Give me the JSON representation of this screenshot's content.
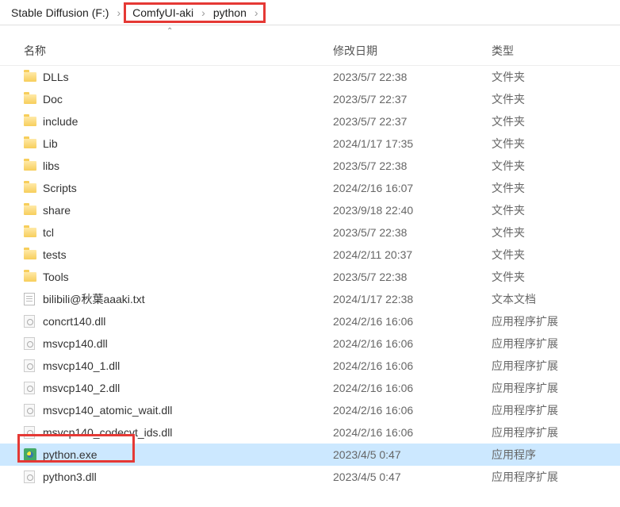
{
  "breadcrumb": {
    "root": "Stable Diffusion (F:)",
    "seg1": "ComfyUI-aki",
    "seg2": "python"
  },
  "headers": {
    "name": "名称",
    "date": "修改日期",
    "type": "类型"
  },
  "types": {
    "folder": "文件夹",
    "txt": "文本文档",
    "dll": "应用程序扩展",
    "exe": "应用程序"
  },
  "files": [
    {
      "icon": "folder",
      "name": "DLLs",
      "date": "2023/5/7 22:38",
      "type_key": "folder"
    },
    {
      "icon": "folder",
      "name": "Doc",
      "date": "2023/5/7 22:37",
      "type_key": "folder"
    },
    {
      "icon": "folder",
      "name": "include",
      "date": "2023/5/7 22:37",
      "type_key": "folder"
    },
    {
      "icon": "folder",
      "name": "Lib",
      "date": "2024/1/17 17:35",
      "type_key": "folder"
    },
    {
      "icon": "folder",
      "name": "libs",
      "date": "2023/5/7 22:38",
      "type_key": "folder"
    },
    {
      "icon": "folder",
      "name": "Scripts",
      "date": "2024/2/16 16:07",
      "type_key": "folder"
    },
    {
      "icon": "folder",
      "name": "share",
      "date": "2023/9/18 22:40",
      "type_key": "folder"
    },
    {
      "icon": "folder",
      "name": "tcl",
      "date": "2023/5/7 22:38",
      "type_key": "folder"
    },
    {
      "icon": "folder",
      "name": "tests",
      "date": "2024/2/11 20:37",
      "type_key": "folder"
    },
    {
      "icon": "folder",
      "name": "Tools",
      "date": "2023/5/7 22:38",
      "type_key": "folder"
    },
    {
      "icon": "txt",
      "name": "bilibili@秋葉aaaki.txt",
      "date": "2024/1/17 22:38",
      "type_key": "txt"
    },
    {
      "icon": "dll",
      "name": "concrt140.dll",
      "date": "2024/2/16 16:06",
      "type_key": "dll"
    },
    {
      "icon": "dll",
      "name": "msvcp140.dll",
      "date": "2024/2/16 16:06",
      "type_key": "dll"
    },
    {
      "icon": "dll",
      "name": "msvcp140_1.dll",
      "date": "2024/2/16 16:06",
      "type_key": "dll"
    },
    {
      "icon": "dll",
      "name": "msvcp140_2.dll",
      "date": "2024/2/16 16:06",
      "type_key": "dll"
    },
    {
      "icon": "dll",
      "name": "msvcp140_atomic_wait.dll",
      "date": "2024/2/16 16:06",
      "type_key": "dll"
    },
    {
      "icon": "dll",
      "name": "msvcp140_codecvt_ids.dll",
      "date": "2024/2/16 16:06",
      "type_key": "dll"
    },
    {
      "icon": "exe",
      "name": "python.exe",
      "date": "2023/4/5 0:47",
      "type_key": "exe",
      "selected": true
    },
    {
      "icon": "dll",
      "name": "python3.dll",
      "date": "2023/4/5 0:47",
      "type_key": "dll"
    }
  ]
}
